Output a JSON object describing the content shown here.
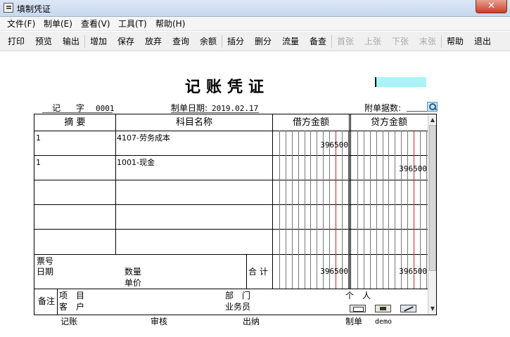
{
  "window": {
    "title": "填制凭证",
    "close_glyph": "✕"
  },
  "menu": [
    "文件(F)",
    "制单(E)",
    "查看(V)",
    "工具(T)",
    "帮助(H)"
  ],
  "toolbar": {
    "buttons": [
      {
        "label": "打印",
        "enabled": true
      },
      {
        "label": "预览",
        "enabled": true
      },
      {
        "label": "输出",
        "enabled": true
      },
      {
        "label": "增加",
        "enabled": true
      },
      {
        "label": "保存",
        "enabled": true
      },
      {
        "label": "放弃",
        "enabled": true
      },
      {
        "label": "查询",
        "enabled": true
      },
      {
        "label": "余额",
        "enabled": true
      },
      {
        "label": "插分",
        "enabled": true
      },
      {
        "label": "删分",
        "enabled": true
      },
      {
        "label": "流量",
        "enabled": true
      },
      {
        "label": "备查",
        "enabled": true
      },
      {
        "label": "首张",
        "enabled": false
      },
      {
        "label": "上张",
        "enabled": false
      },
      {
        "label": "下张",
        "enabled": false
      },
      {
        "label": "末张",
        "enabled": false
      },
      {
        "label": "帮助",
        "enabled": true
      },
      {
        "label": "退出",
        "enabled": true
      }
    ]
  },
  "voucher": {
    "title": "记账凭证",
    "type_label": "记",
    "zi_label": "字",
    "number": "0001",
    "date_label": "制单日期:",
    "date": "2019.02.17",
    "attachments_label": "附单据数:",
    "columns": {
      "summary": "摘 要",
      "account": "科目名称",
      "debit": "借方金额",
      "credit": "贷方金额"
    },
    "rows": [
      {
        "summary": "1",
        "account": "4107-劳务成本",
        "debit": "396500",
        "credit": ""
      },
      {
        "summary": "1",
        "account": "1001-现金",
        "debit": "",
        "credit": "396500"
      },
      {
        "summary": "",
        "account": "",
        "debit": "",
        "credit": ""
      },
      {
        "summary": "",
        "account": "",
        "debit": "",
        "credit": ""
      },
      {
        "summary": "",
        "account": "",
        "debit": "",
        "credit": ""
      }
    ],
    "ticket_no_label": "票号",
    "ticket_date_label": "日期",
    "quantity_label": "数量",
    "unit_price_label": "单价",
    "total_label": "合 计",
    "total_debit": "396500",
    "total_credit": "396500",
    "remarks_label": "备注",
    "project_label": "项　目",
    "customer_label": "客　户",
    "dept_label": "部　门",
    "clerk_label": "业务员",
    "person_label": "个　人"
  },
  "signatures": {
    "bookkeeper_label": "记账",
    "auditor_label": "审核",
    "cashier_label": "出纳",
    "maker_label": "制单",
    "maker_name": "demo"
  }
}
